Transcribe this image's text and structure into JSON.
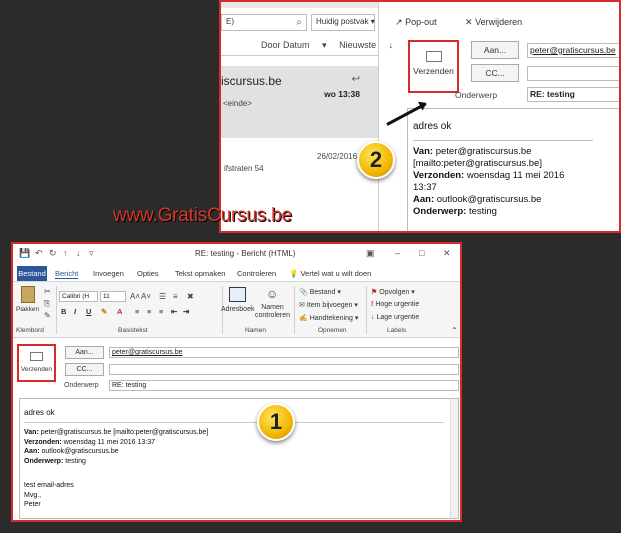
{
  "top": {
    "search_text": "E)",
    "mailbox_scope": "Huidig postvak",
    "sort_by": "Door Datum",
    "sort_order": "Nieuwste",
    "selected_msg": {
      "sender": "iscursus.be",
      "time": "wo 13:38",
      "preview": "<einde>"
    },
    "msg2": {
      "date": "26/02/2016",
      "address": "ifstraten 54"
    },
    "popout_label": "Pop-out",
    "delete_label": "Verwijderen",
    "send_label": "Verzenden",
    "to_label": "Aan...",
    "cc_label": "CC...",
    "subject_label": "Onderwerp",
    "to_value": "peter@gratiscursus.be",
    "subject_value": "RE: testing",
    "body_reply": "adres ok",
    "hdr_van_k": "Van:",
    "hdr_van_v": "peter@gratiscursus.be",
    "hdr_mailto": "[mailto:peter@gratiscursus.be]",
    "hdr_verz_k": "Verzonden:",
    "hdr_verz_v": "woensdag 11 mei 2016",
    "hdr_verz_v2": "13:37",
    "hdr_aan_k": "Aan:",
    "hdr_aan_v": "outlook@gratiscursus.be",
    "hdr_ond_k": "Onderwerp:",
    "hdr_ond_v": "testing",
    "badge": "2"
  },
  "watermark": "www.GratisCursus.be",
  "win": {
    "title": "RE: testing - Bericht (HTML)",
    "tabs": [
      "Bestand",
      "Bericht",
      "Invoegen",
      "Opties",
      "Tekst opmaken",
      "Controleren"
    ],
    "tell_me": "Vertel wat u wilt doen",
    "paste_label": "Plakken",
    "font_name": "Calibri (H",
    "font_size": "11",
    "groups": [
      "Klembord",
      "Basistekst",
      "Namen",
      "Opnemen",
      "Labels"
    ],
    "adresboek": "Adresboek",
    "namen_controleren": [
      "Namen",
      "controleren"
    ],
    "opnemen": [
      "Bestand",
      "Item bijvoegen",
      "Handtekening"
    ],
    "labels": [
      "Opvolgen",
      "Hoge urgentie",
      "Lage urgentie"
    ],
    "send_label": "Verzenden",
    "to_label": "Aan...",
    "cc_label": "CC...",
    "subject_label": "Onderwerp",
    "to_value": "peter@gratiscursus.be",
    "subject_value": "RE: testing",
    "body_reply": "adres ok",
    "hdr_van_k": "Van:",
    "hdr_van_v": "peter@gratiscursus.be [mailto:peter@gratiscursus.be]",
    "hdr_verz_k": "Verzonden:",
    "hdr_verz_v": "woensdag 11 mei 2016 13:37",
    "hdr_aan_k": "Aan:",
    "hdr_aan_v": "outlook@gratiscursus.be",
    "hdr_ond_k": "Onderwerp:",
    "hdr_ond_v": "testing",
    "sig1": "test email-adres",
    "sig2": "Mvg.,",
    "sig3": "Peter",
    "badge": "1"
  }
}
